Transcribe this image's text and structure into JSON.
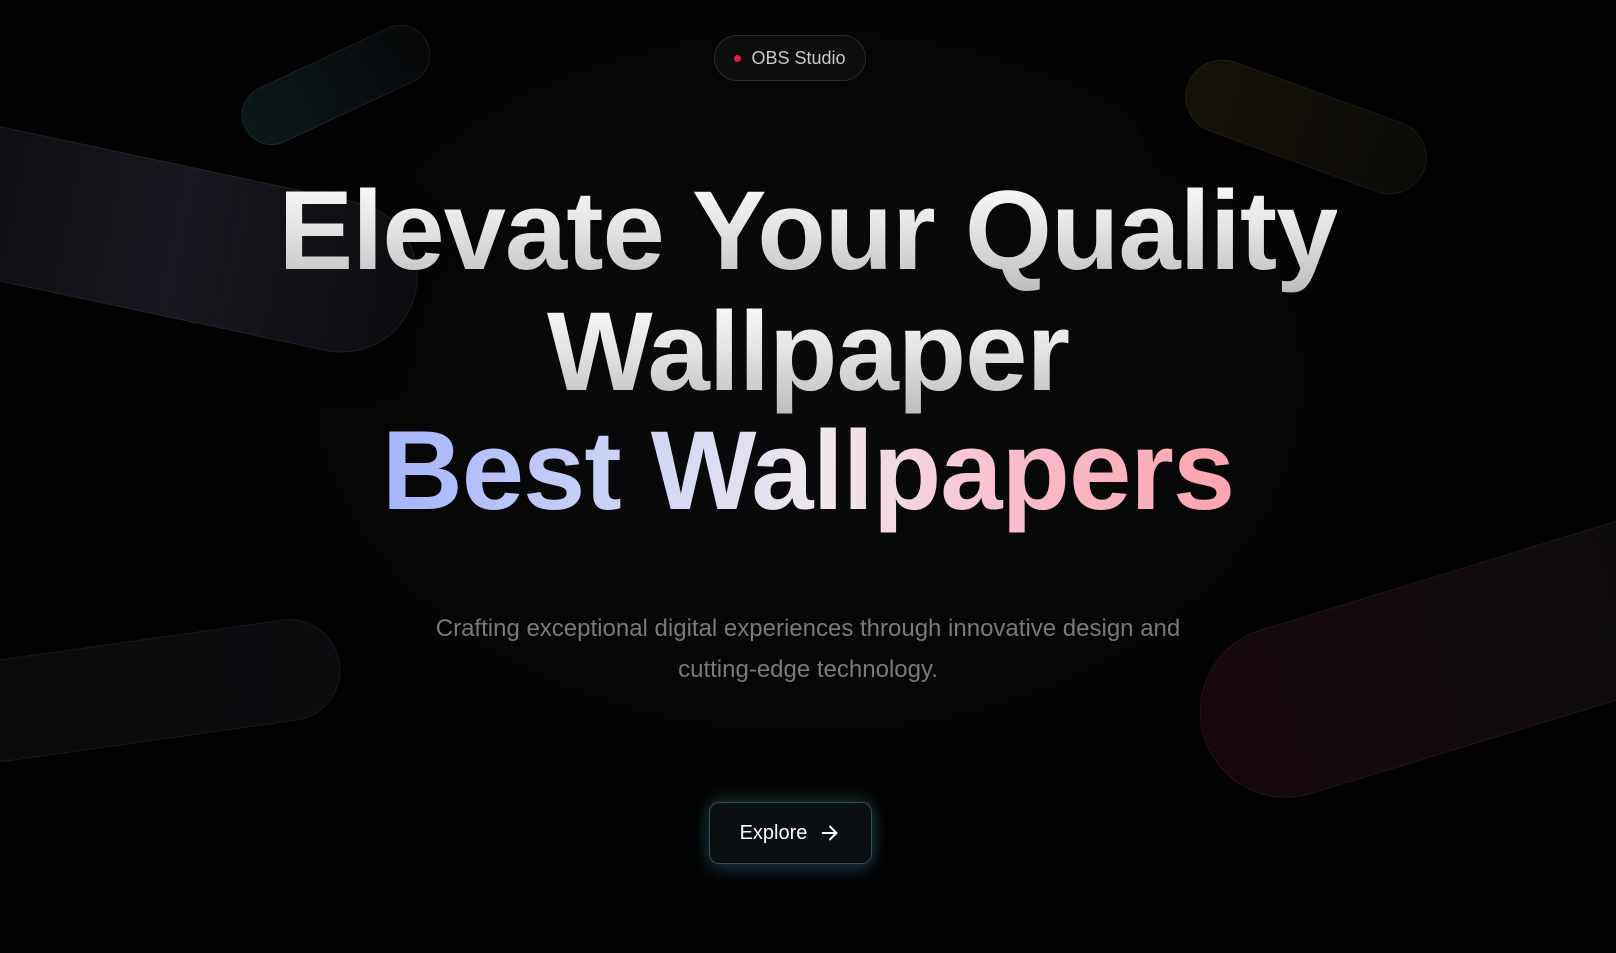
{
  "badge": {
    "label": "OBS Studio",
    "dot_color": "#e11d48"
  },
  "hero": {
    "title_line_1": "Elevate Your Quality",
    "title_line_2": "Wallpaper",
    "title_line_3": "Best Wallpapers",
    "gradient_colors": [
      "#a5b4fc",
      "#f0e8ec",
      "#fda4af"
    ],
    "subtitle": "Crafting exceptional digital experiences through innovative design and cutting-edge technology."
  },
  "cta": {
    "label": "Explore",
    "icon": "arrow-right-icon"
  },
  "theme": {
    "background": "#040404",
    "text_muted": "#7a7a7e"
  }
}
